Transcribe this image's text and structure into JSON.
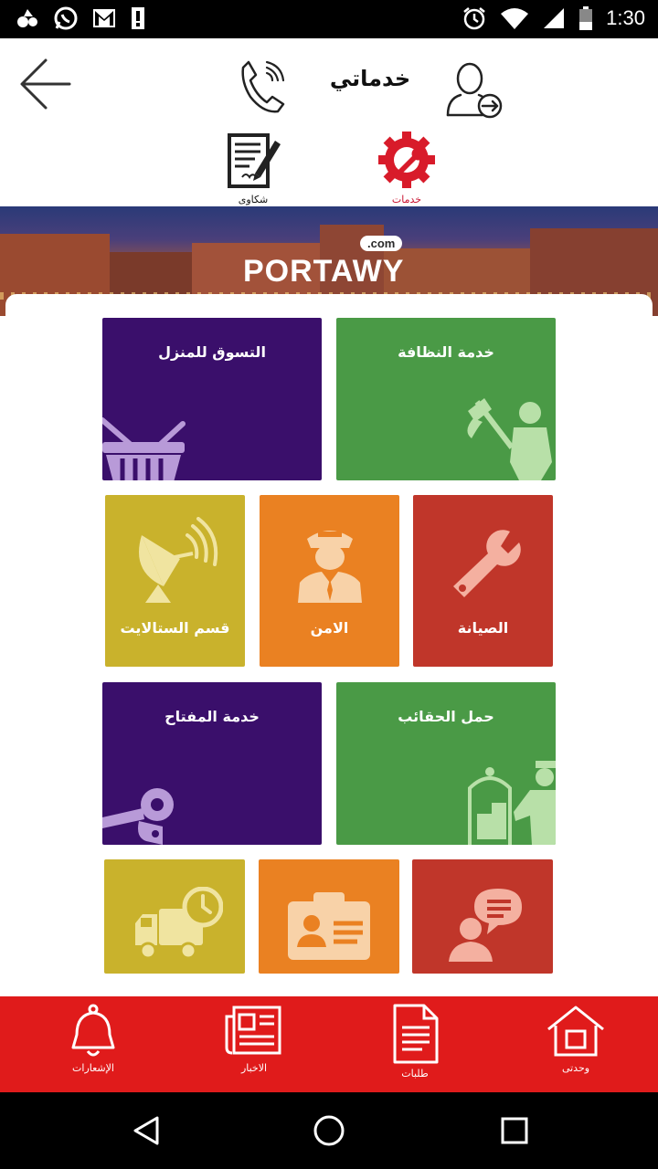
{
  "status_bar": {
    "time": "1:30",
    "icons_left": [
      "app-notification-icon",
      "whatsapp-icon",
      "gmail-icon",
      "alert-icon"
    ],
    "icons_right": [
      "alarm-icon",
      "wifi-icon",
      "signal-icon",
      "battery-icon"
    ]
  },
  "header": {
    "title": "خدماتي"
  },
  "subtabs": {
    "complaints_label": "شكاوى",
    "services_label": "خدمات"
  },
  "banner": {
    "logo_text": "PORTAWY",
    "logo_suffix": ".com"
  },
  "tiles": [
    {
      "label": "التسوق للمنزل",
      "color": "#3a0f6b",
      "icon": "basket-icon"
    },
    {
      "label": "خدمة النظافة",
      "color": "#4a9a46",
      "icon": "cleaner-icon"
    },
    {
      "label": "قسم الستالايت",
      "color": "#c9b22c",
      "icon": "satellite-dish-icon"
    },
    {
      "label": "الامن",
      "color": "#ea8122",
      "icon": "security-guard-icon"
    },
    {
      "label": "الصيانة",
      "color": "#c0362a",
      "icon": "wrench-icon"
    },
    {
      "label": "خدمة المفتاح",
      "color": "#3a0f6b",
      "icon": "key-icon"
    },
    {
      "label": "حمل الحقائب",
      "color": "#4a9a46",
      "icon": "bellboy-icon"
    },
    {
      "label": "",
      "color": "#c9b22c",
      "icon": "delivery-truck-icon"
    },
    {
      "label": "",
      "color": "#ea8122",
      "icon": "id-card-icon"
    },
    {
      "label": "",
      "color": "#c0362a",
      "icon": "customer-support-icon"
    }
  ],
  "bottom_nav": {
    "notifications": "الإشعارات",
    "news": "الاخبار",
    "requests": "طلبات",
    "my_unit": "وحدتى"
  },
  "colors": {
    "accent_red": "#e01b1b",
    "purple": "#3a0f6b",
    "green": "#4a9a46",
    "yellow": "#c9b22c",
    "orange": "#ea8122",
    "red": "#c0362a"
  }
}
